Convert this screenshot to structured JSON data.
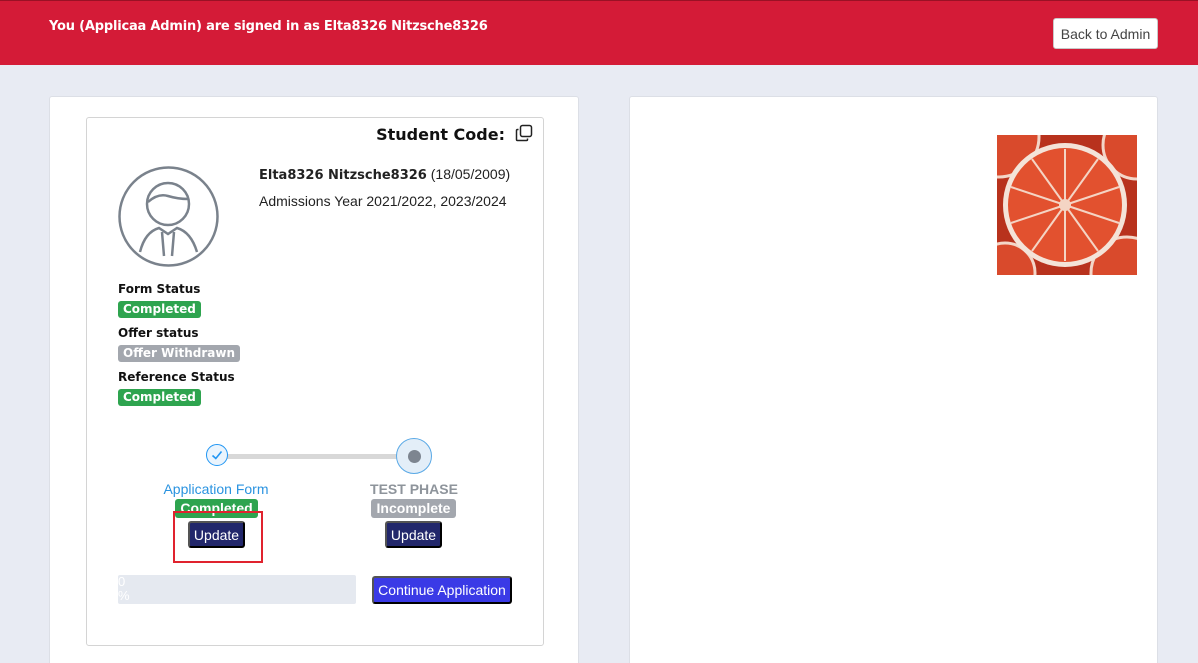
{
  "banner": {
    "signed_in_text": "You (Applicaa Admin) are signed in as Elta8326 Nitzsche8326",
    "back_button": "Back to Admin"
  },
  "profile": {
    "student_code_label": "Student Code:",
    "name": "Elta8326 Nitzsche8326",
    "dob": "(18/05/2009)",
    "admissions": "Admissions Year 2021/2022, 2023/2024"
  },
  "statuses": [
    {
      "label": "Form Status",
      "value": "Completed",
      "color": "#2ea44f"
    },
    {
      "label": "Offer status",
      "value": "Offer Withdrawn",
      "color": "#a3a7ae"
    },
    {
      "label": "Reference Status",
      "value": "Completed",
      "color": "#2ea44f"
    }
  ],
  "steps": [
    {
      "title": "Application Form",
      "status": "Completed",
      "button": "Update",
      "icon": "check-icon"
    },
    {
      "title": "TEST PHASE",
      "status": "Incomplete",
      "button": "Update",
      "icon": "current-step-dot"
    }
  ],
  "progress": {
    "value": 0,
    "label": "0 %"
  },
  "continue_button": "Continue Application",
  "colors": {
    "banner": "#d41b37",
    "primary_button": "#22276b",
    "continue_button": "#3a3ae6",
    "step_active": "#2196f3"
  }
}
